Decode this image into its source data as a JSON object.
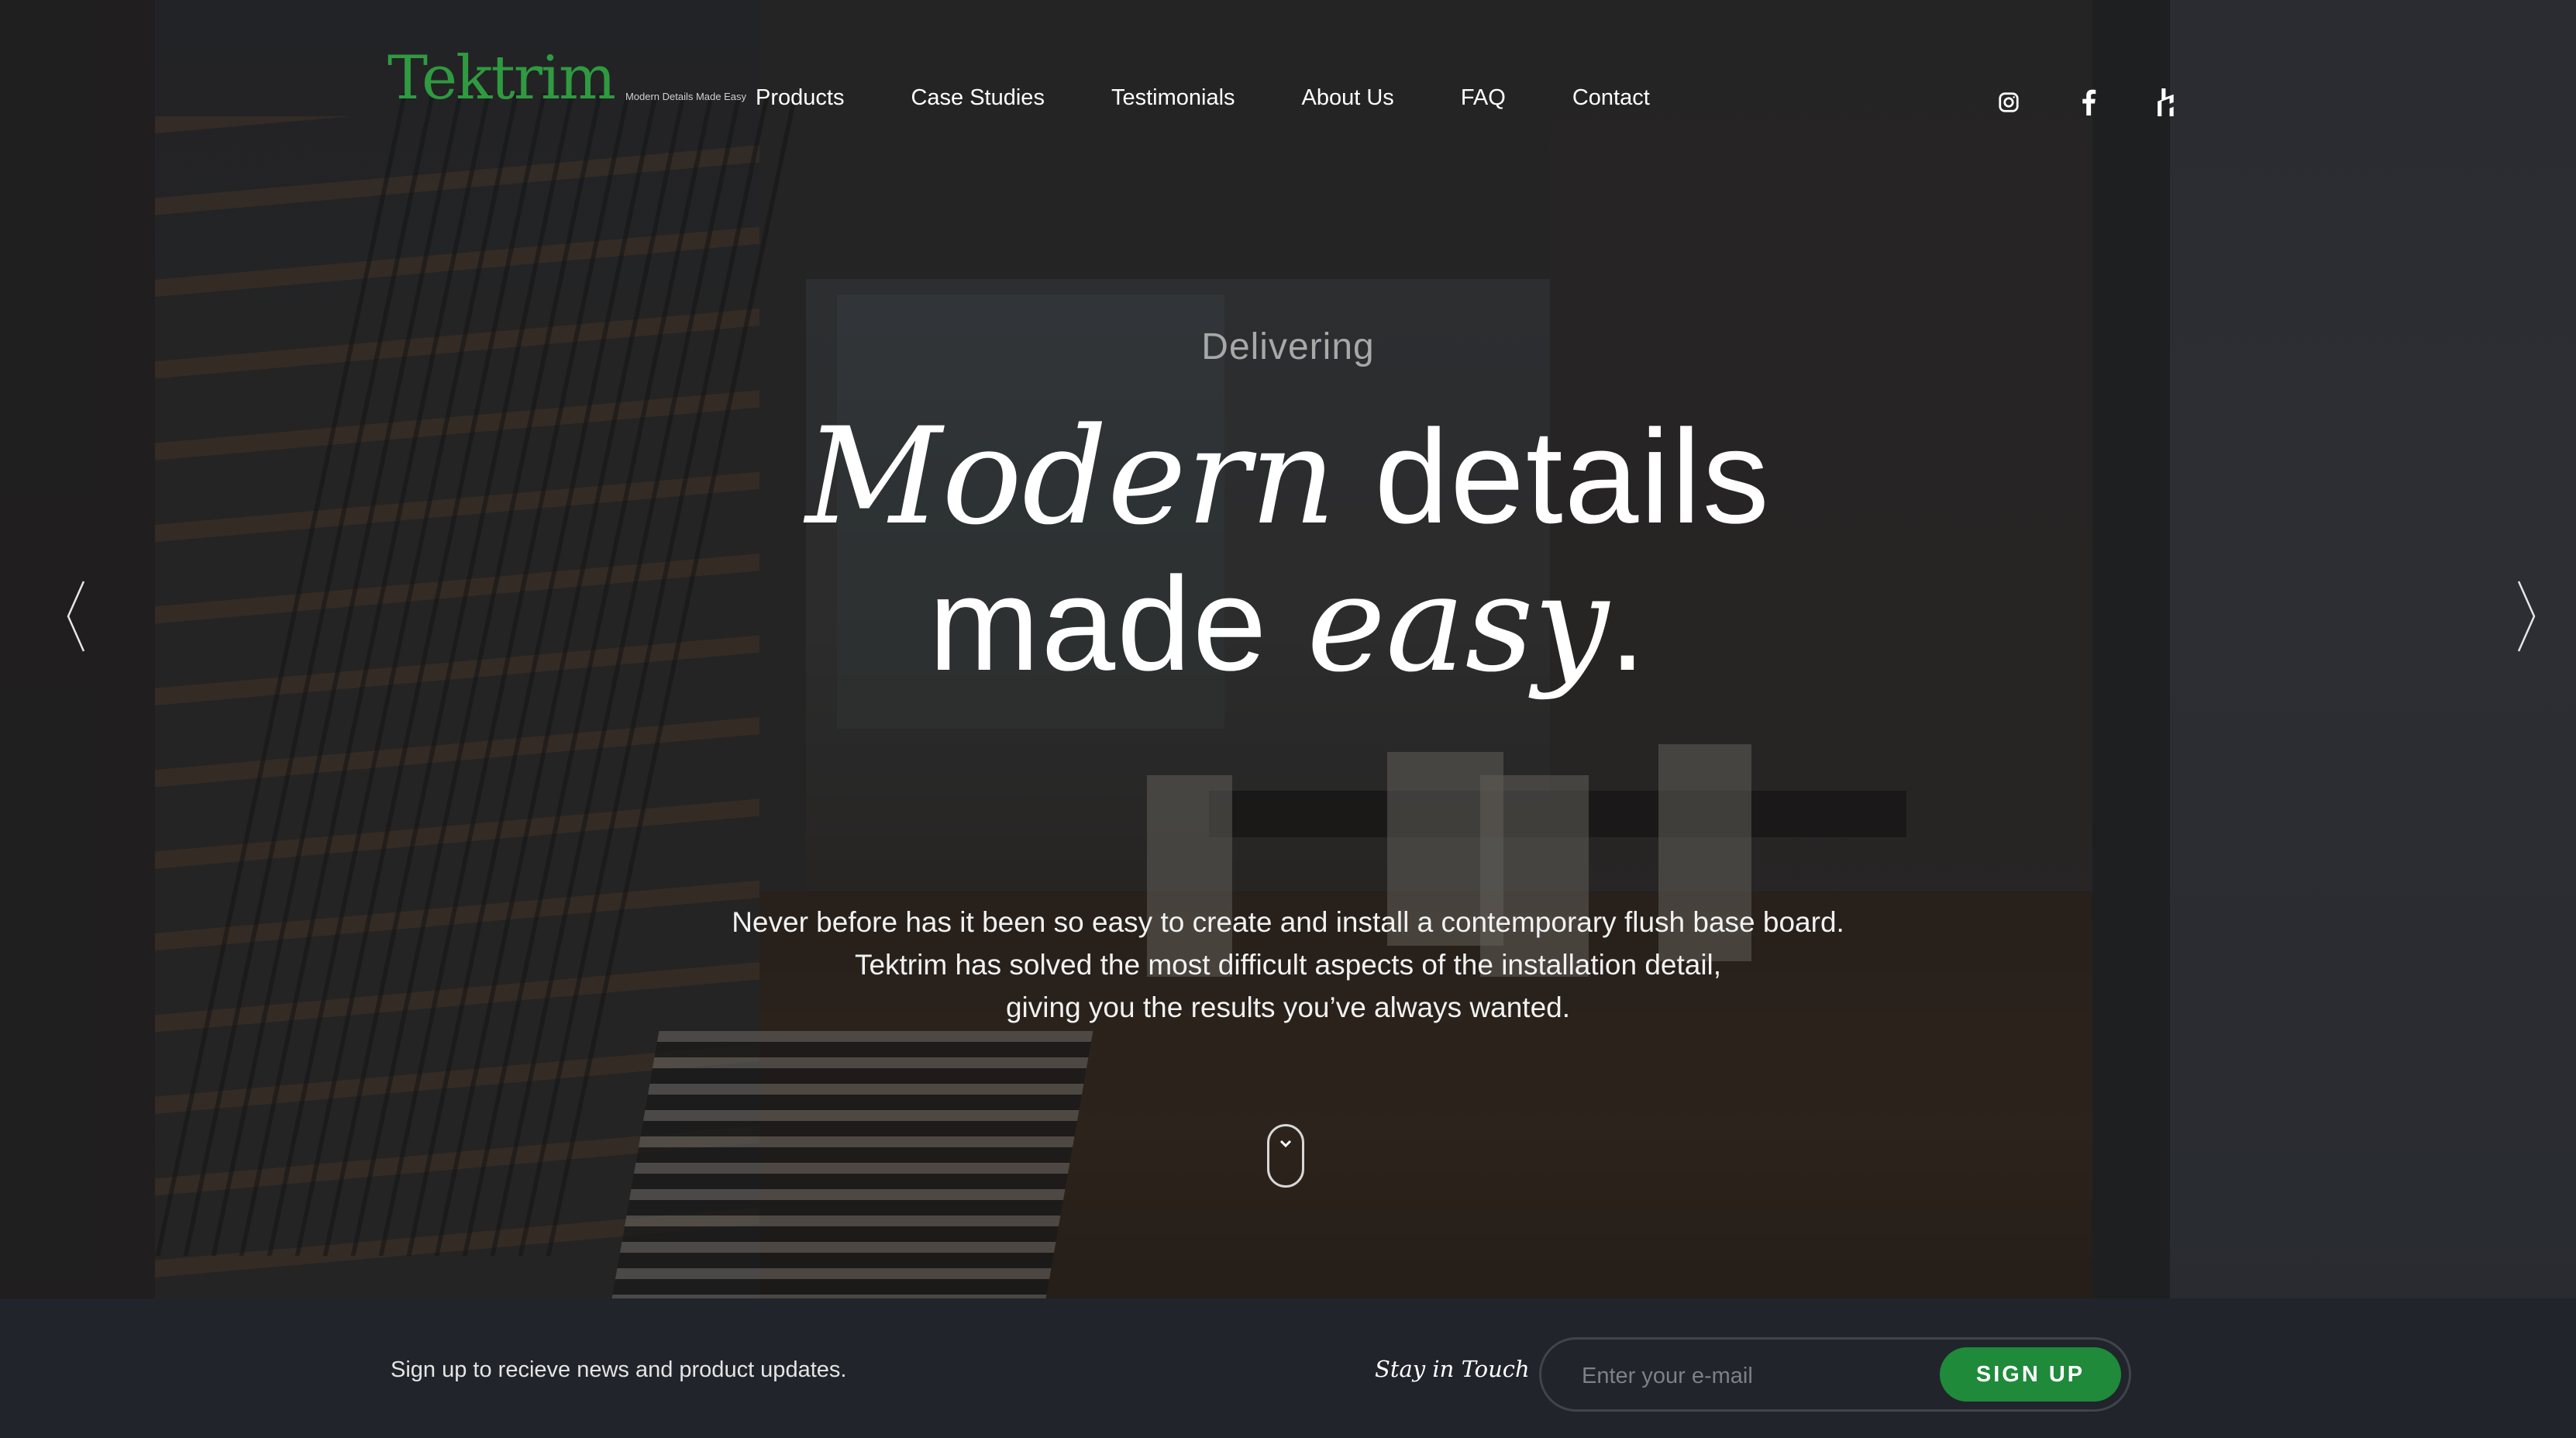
{
  "brand": {
    "logo_text": "Tektrim",
    "tagline": "Modern Details Made Easy",
    "accent": "#2f9a3f"
  },
  "nav": {
    "items": [
      {
        "label": "Products"
      },
      {
        "label": "Case Studies"
      },
      {
        "label": "Testimonials"
      },
      {
        "label": "About Us"
      },
      {
        "label": "FAQ"
      },
      {
        "label": "Contact"
      }
    ]
  },
  "social": [
    {
      "icon": "instagram-icon"
    },
    {
      "icon": "facebook-icon"
    },
    {
      "icon": "houzz-icon"
    }
  ],
  "hero": {
    "eyebrow": "Delivering",
    "headline_1_it": "Modern",
    "headline_1_rg": " details",
    "headline_2_rg": "made ",
    "headline_2_it": "easy",
    "headline_2_end": ".",
    "body_line_1": "Never before has it been so easy to create and install a contemporary flush base board.",
    "body_line_2": "Tektrim has solved the most difficult aspects of the installation detail,",
    "body_line_3": "giving you the results you’ve always wanted.",
    "prev_icon": "chevron-left-icon",
    "next_icon": "chevron-right-icon",
    "scroll_icon": "chevron-down-icon"
  },
  "signup": {
    "text": "Sign up to recieve news and product updates.",
    "stay_label": "Stay in Touch",
    "email_placeholder": "Enter your e-mail",
    "button_label": "SIGN UP",
    "button_color": "#1e8a3a",
    "bar_color": "#21242b"
  }
}
